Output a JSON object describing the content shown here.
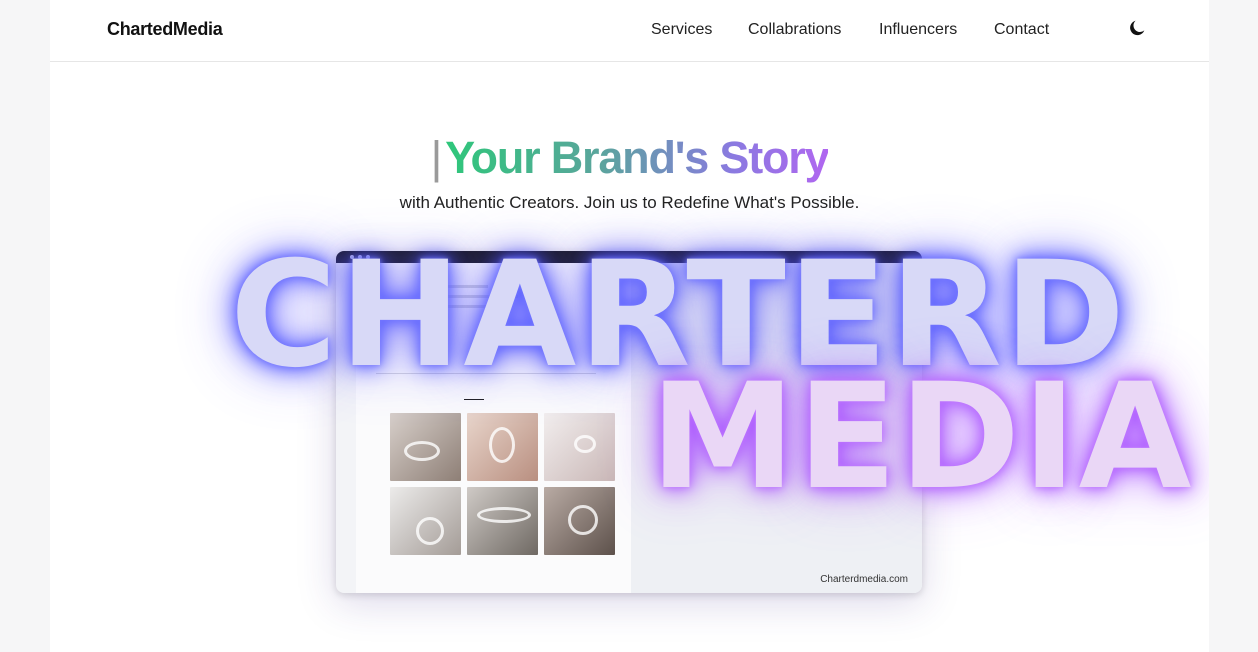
{
  "header": {
    "logo": "ChartedMedia",
    "nav": [
      "Services",
      "Collabrations",
      "Influencers",
      "Contact"
    ],
    "theme_icon": "moon-icon"
  },
  "hero": {
    "caret": "|",
    "title": "Your Brand's Story",
    "subtitle": "with Authentic Creators. Join us to Redefine What's Possible."
  },
  "showcase": {
    "overlay_line1": "CHARTERD",
    "overlay_line2": "MEDIA",
    "site_url": "Charterdmedia.com",
    "tiles": [
      "ring-photo",
      "ring-photo",
      "ring-photo",
      "ring-photo",
      "ring-photo",
      "ring-photo"
    ]
  },
  "colors": {
    "gradient_start": "#2ec77a",
    "gradient_end": "#b066f0",
    "charterd_glow": "#4e55ff",
    "media_glow": "#a44cff"
  }
}
